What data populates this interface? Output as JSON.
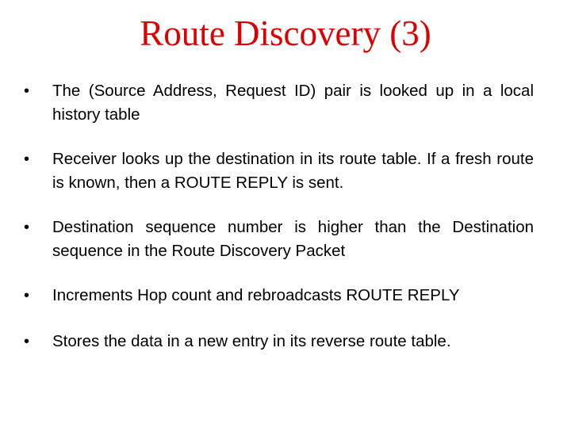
{
  "slide": {
    "title": "Route Discovery (3)",
    "title_color": "#dd0000",
    "bullet_glyph": "•",
    "bullets": [
      {
        "text": "The (Source Address, Request ID) pair is looked up in a local history table"
      },
      {
        "text": "Receiver looks up the destination in its route table. If a fresh route is known, then a ROUTE REPLY is sent."
      },
      {
        "text": "Destination sequence number is higher than the Destination sequence in the Route Discovery Packet"
      },
      {
        "text": "Increments Hop count and rebroadcasts ROUTE REPLY"
      },
      {
        "text": "Stores the data in a new entry in its reverse route table."
      }
    ]
  }
}
